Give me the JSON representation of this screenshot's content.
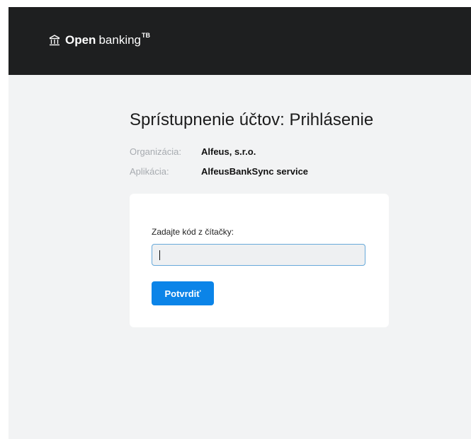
{
  "header": {
    "brand_strong": "Open",
    "brand_light": "banking",
    "brand_sup": "TB",
    "icon": "bank-icon",
    "background": "#1e1f20"
  },
  "page": {
    "title": "Sprístupnenie účtov: Prihlásenie",
    "meta": [
      {
        "label": "Organizácia:",
        "value": "Alfeus, s.r.o."
      },
      {
        "label": "Aplikácia:",
        "value": "AlfeusBankSync service"
      }
    ]
  },
  "form": {
    "code_label": "Zadajte kód z čítačky:",
    "code_value": "",
    "confirm_label": "Potvrdiť",
    "accent": "#0b84e8"
  }
}
